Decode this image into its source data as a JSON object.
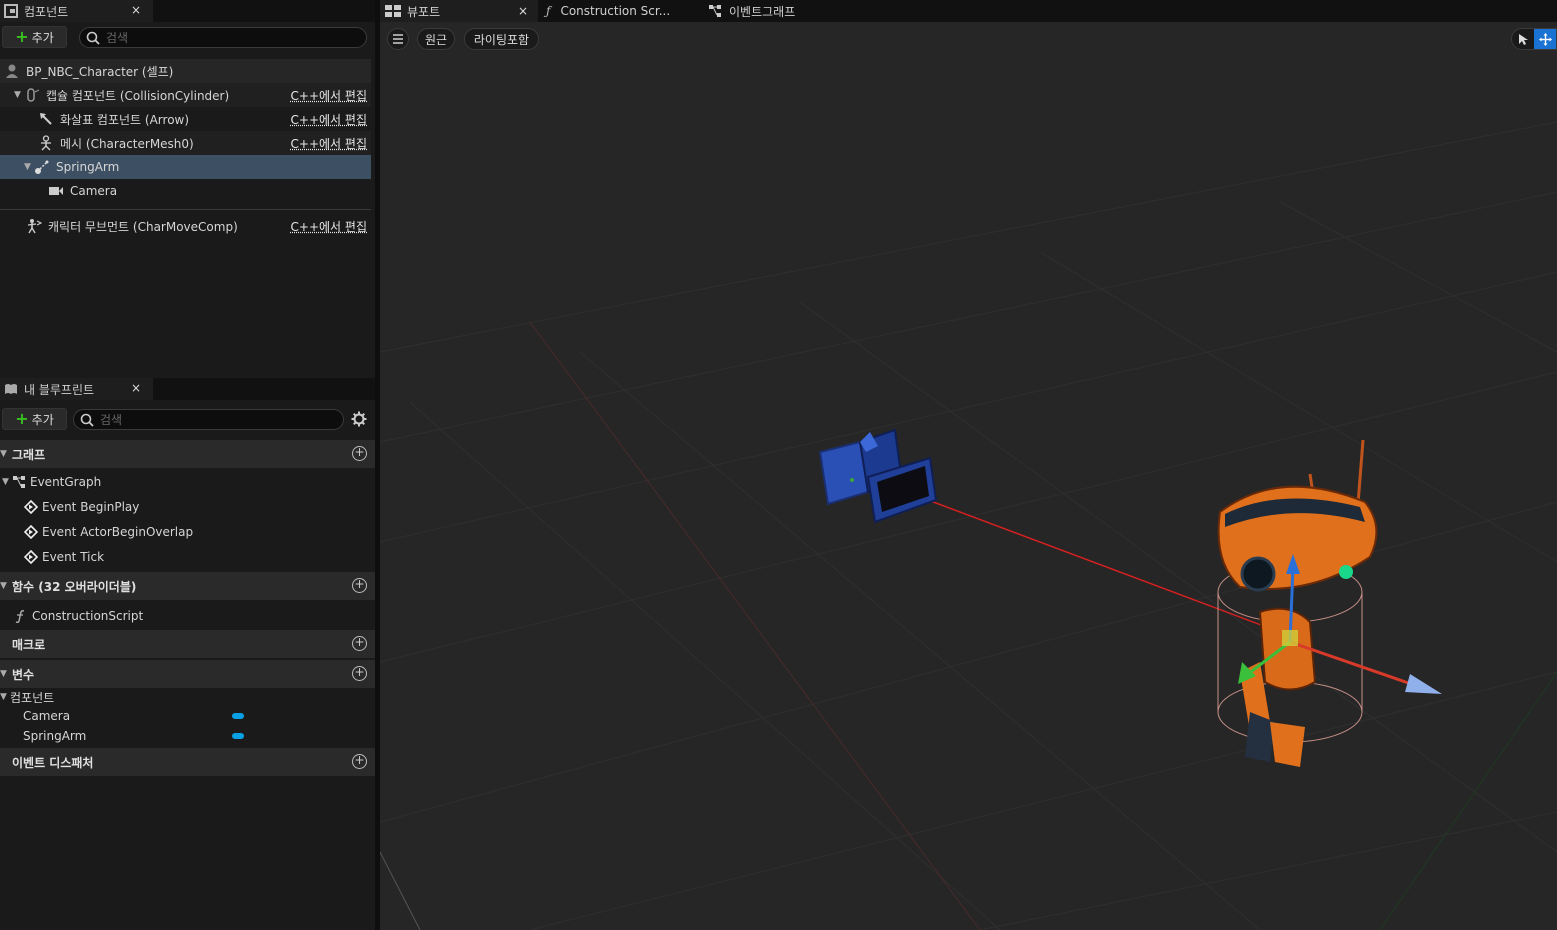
{
  "components_panel": {
    "tab_label": "컴포넌트",
    "close": "×",
    "add_label": "추가",
    "search_placeholder": "검색",
    "tree": [
      {
        "label": "BP_NBC_Character (셀프)",
        "edit": ""
      },
      {
        "label": "캡슐 컴포넌트 (CollisionCylinder)",
        "edit": "C++에서 편집"
      },
      {
        "label": "화살표 컴포넌트 (Arrow)",
        "edit": "C++에서 편집"
      },
      {
        "label": "메시 (CharacterMesh0)",
        "edit": "C++에서 편집"
      },
      {
        "label": "SpringArm",
        "edit": ""
      },
      {
        "label": "Camera",
        "edit": ""
      },
      {
        "label": "캐릭터 무브먼트 (CharMoveComp)",
        "edit": "C++에서 편집"
      }
    ]
  },
  "blueprint_panel": {
    "tab_label": "내 블루프린트",
    "close": "×",
    "add_label": "추가",
    "search_placeholder": "검색",
    "sections": {
      "graph": "그래프",
      "functions": "함수 (32 오버라이더블)",
      "macros": "매크로",
      "variables": "변수",
      "dispatchers": "이벤트 디스패처"
    },
    "event_graph": "EventGraph",
    "events": [
      "Event BeginPlay",
      "Event ActorBeginOverlap",
      "Event Tick"
    ],
    "functions": [
      "ConstructionScript"
    ],
    "var_category": "컴포넌트",
    "variables": [
      "Camera",
      "SpringArm"
    ],
    "var_color": "#0aa0e6"
  },
  "editor_tabs": [
    {
      "label": "뷰포트",
      "close": "×"
    },
    {
      "label": "Construction Scr..."
    },
    {
      "label": "이벤트그래프"
    }
  ],
  "viewport": {
    "view_mode": "원근",
    "lighting": "라이팅포함"
  },
  "colors": {
    "accent_blue": "#1a72d2",
    "selected_row": "#3d4f63",
    "add_green": "#38c020"
  }
}
